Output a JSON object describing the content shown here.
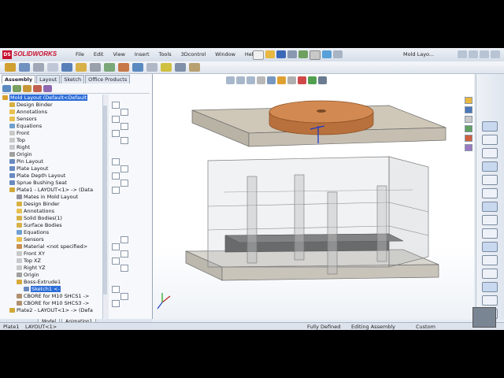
{
  "window": {
    "brand": "SOLIDWORKS",
    "logo": "DS",
    "doc_title": "Mold Layo...",
    "menus": [
      "File",
      "Edit",
      "View",
      "Insert",
      "Tools",
      "3Dcontrol",
      "Window",
      "Help"
    ]
  },
  "panel": {
    "tabs": [
      "Assembly",
      "Layout",
      "Sketch",
      "Office Products"
    ],
    "active_tab": "Assembly"
  },
  "tree": [
    {
      "label": "Mold Layout  (Default<Default",
      "indent": 0,
      "selected": true,
      "icon": "assembly-icon"
    },
    {
      "label": "Design Binder",
      "indent": 1,
      "icon": "binder-icon"
    },
    {
      "label": "Annotations",
      "indent": 1,
      "icon": "annotations-icon"
    },
    {
      "label": "Sensors",
      "indent": 1,
      "icon": "sensors-icon"
    },
    {
      "label": "Equations",
      "indent": 1,
      "icon": "equations-icon"
    },
    {
      "label": "Front",
      "indent": 1,
      "icon": "plane-icon"
    },
    {
      "label": "Top",
      "indent": 1,
      "icon": "plane-icon"
    },
    {
      "label": "Right",
      "indent": 1,
      "icon": "plane-icon"
    },
    {
      "label": "Origin",
      "indent": 1,
      "icon": "origin-icon"
    },
    {
      "label": "Pin Layout",
      "indent": 1,
      "icon": "sketch-icon"
    },
    {
      "label": "Plate Layout",
      "indent": 1,
      "icon": "sketch-icon"
    },
    {
      "label": "Plate Depth Layout",
      "indent": 1,
      "icon": "sketch-icon"
    },
    {
      "label": "Sprue Bushing Seat",
      "indent": 1,
      "icon": "sketch-icon"
    },
    {
      "label": "Plate1 - LAYOUT<1> -> (Data",
      "indent": 1,
      "icon": "part-icon"
    },
    {
      "label": "Mates in Mold Layout",
      "indent": 2,
      "icon": "mates-icon"
    },
    {
      "label": "Design Binder",
      "indent": 2,
      "icon": "binder-icon"
    },
    {
      "label": "Annotations",
      "indent": 2,
      "icon": "annotations-icon"
    },
    {
      "label": "Solid Bodies(1)",
      "indent": 2,
      "icon": "bodies-icon"
    },
    {
      "label": "Surface Bodies",
      "indent": 2,
      "icon": "bodies-icon"
    },
    {
      "label": "Equations",
      "indent": 2,
      "icon": "equations-icon"
    },
    {
      "label": "Sensors",
      "indent": 2,
      "icon": "sensors-icon"
    },
    {
      "label": "Material <not specified>",
      "indent": 2,
      "icon": "material-icon"
    },
    {
      "label": "Front XY",
      "indent": 2,
      "icon": "plane-icon"
    },
    {
      "label": "Top XZ",
      "indent": 2,
      "icon": "plane-icon"
    },
    {
      "label": "Right YZ",
      "indent": 2,
      "icon": "plane-icon"
    },
    {
      "label": "Origin",
      "indent": 2,
      "icon": "origin-icon"
    },
    {
      "label": "Boss-Extrude1",
      "indent": 2,
      "icon": "extrude-icon"
    },
    {
      "label": "Sketch1 <-",
      "indent": 3,
      "selected": true,
      "icon": "sketch-icon"
    },
    {
      "label": "CBORE for M10 SHCS1 ->",
      "indent": 2,
      "icon": "hole-icon"
    },
    {
      "label": "CBORE for M10 SHCS3 ->",
      "indent": 2,
      "icon": "hole-icon"
    },
    {
      "label": "Plate2 - LAYOUT<1> -> (Defa",
      "indent": 1,
      "icon": "part-icon"
    }
  ],
  "bottom_tabs": [
    "Model",
    "Animation1"
  ],
  "status": {
    "part": "Plate1",
    "layout": "LAYOUT<1>",
    "defined": "Fully Defined",
    "mode": "Editing Assembly",
    "units": "Custom"
  },
  "colors": {
    "accent": "#2b6cd8",
    "brand_red": "#c8102e",
    "plate_top": "#cfc7b8",
    "plate_side": "#bdb7ab",
    "ring": "#c8824e",
    "dark_plate": "#4a4a4a"
  }
}
